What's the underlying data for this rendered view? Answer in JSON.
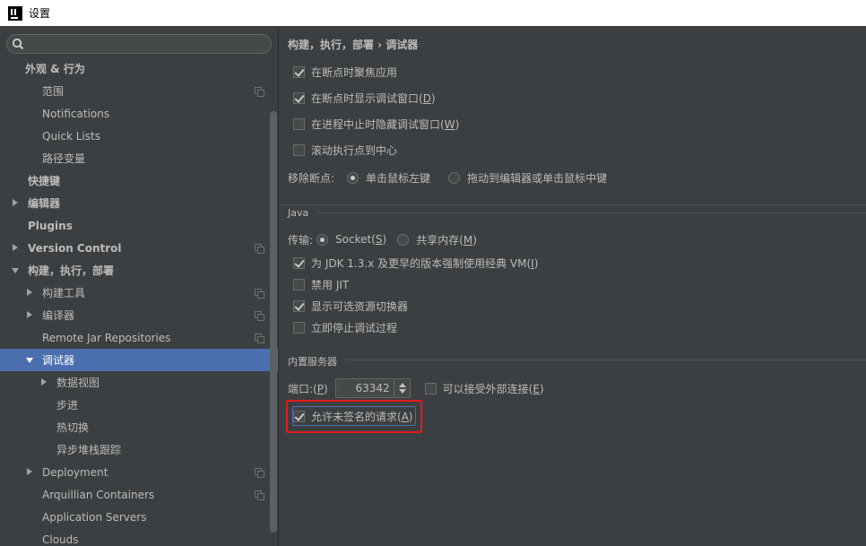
{
  "window": {
    "title": "设置"
  },
  "search": {
    "placeholder": ""
  },
  "sidebar": {
    "items": [
      {
        "label": "外观 & 行为",
        "indent": 28,
        "bold": true,
        "arrow": "none",
        "copy": false
      },
      {
        "label": "范围",
        "indent": 47,
        "bold": false,
        "arrow": "none",
        "copy": true
      },
      {
        "label": "Notifications",
        "indent": 47,
        "bold": false,
        "arrow": "none",
        "copy": false
      },
      {
        "label": "Quick Lists",
        "indent": 47,
        "bold": false,
        "arrow": "none",
        "copy": false
      },
      {
        "label": "路径变量",
        "indent": 47,
        "bold": false,
        "arrow": "none",
        "copy": false
      },
      {
        "label": "快捷键",
        "indent": 31,
        "bold": true,
        "arrow": "none",
        "copy": false
      },
      {
        "label": "编辑器",
        "indent": 31,
        "bold": true,
        "arrow": "right",
        "copy": false
      },
      {
        "label": "Plugins",
        "indent": 31,
        "bold": true,
        "arrow": "none",
        "copy": false
      },
      {
        "label": "Version Control",
        "indent": 31,
        "bold": true,
        "arrow": "right",
        "copy": true
      },
      {
        "label": "构建，执行，部署",
        "indent": 31,
        "bold": true,
        "arrow": "down",
        "copy": false
      },
      {
        "label": "构建工具",
        "indent": 47,
        "bold": false,
        "arrow": "right",
        "copy": true
      },
      {
        "label": "编译器",
        "indent": 47,
        "bold": false,
        "arrow": "right",
        "copy": true
      },
      {
        "label": "Remote Jar Repositories",
        "indent": 47,
        "bold": false,
        "arrow": "none",
        "copy": true
      },
      {
        "label": "调试器",
        "indent": 47,
        "bold": false,
        "arrow": "down",
        "copy": false,
        "selected": true
      },
      {
        "label": "数据视图",
        "indent": 63,
        "bold": false,
        "arrow": "right",
        "copy": false
      },
      {
        "label": "步进",
        "indent": 63,
        "bold": false,
        "arrow": "none",
        "copy": false
      },
      {
        "label": "热切换",
        "indent": 63,
        "bold": false,
        "arrow": "none",
        "copy": false
      },
      {
        "label": "异步堆栈跟踪",
        "indent": 63,
        "bold": false,
        "arrow": "none",
        "copy": false
      },
      {
        "label": "Deployment",
        "indent": 47,
        "bold": false,
        "arrow": "right",
        "copy": true
      },
      {
        "label": "Arquillian Containers",
        "indent": 47,
        "bold": false,
        "arrow": "none",
        "copy": true
      },
      {
        "label": "Application Servers",
        "indent": 47,
        "bold": false,
        "arrow": "none",
        "copy": false
      },
      {
        "label": "Clouds",
        "indent": 47,
        "bold": false,
        "arrow": "none",
        "copy": false
      }
    ]
  },
  "content": {
    "breadcrumb": "构建，执行，部署 › 调试器",
    "general": [
      {
        "label": "在断点时聚焦应用",
        "mnemonic": "",
        "checked": true
      },
      {
        "label": "在断点时显示调试窗口(",
        "mnemonic": "D",
        "suffix": ")",
        "checked": true
      },
      {
        "label": "在进程中止时隐藏调试窗口(",
        "mnemonic": "W",
        "suffix": ")",
        "checked": false
      },
      {
        "label": "滚动执行点到中心",
        "mnemonic": "",
        "checked": false
      }
    ],
    "remove_breakpoint": {
      "label": "移除断点:",
      "option1": "单击鼠标左键",
      "option2": "拖动到编辑器或单击鼠标中键",
      "selected": 1
    },
    "java": {
      "section": "Java",
      "transport_label": "传输:",
      "socket_label": "Socket(",
      "socket_mnemonic": "S",
      "shared_label": "共享内存(",
      "shared_mnemonic": "M",
      "selected": "socket",
      "options": [
        {
          "label": "为 JDK 1.3.x 及更早的版本强制使用经典 VM(",
          "mnemonic": "I",
          "suffix": ")",
          "checked": true
        },
        {
          "label": "禁用 JIT",
          "mnemonic": "",
          "suffix": "",
          "checked": false
        },
        {
          "label": "显示可选资源切换器",
          "mnemonic": "",
          "suffix": "",
          "checked": true
        },
        {
          "label": "立即停止调试过程",
          "mnemonic": "",
          "suffix": "",
          "checked": false
        }
      ]
    },
    "builtin_server": {
      "section": "内置服务器",
      "port_label": "端口:(",
      "port_mnemonic": "P",
      "port_suffix": ")",
      "port_value": "63342",
      "external_label": "可以接受外部连接(",
      "external_mnemonic": "E",
      "external_suffix": ")",
      "external_checked": false,
      "unsigned_label": "允许未签名的请求(",
      "unsigned_mnemonic": "A",
      "unsigned_suffix": ")",
      "unsigned_checked": true
    }
  },
  "colors": {
    "background": "#3c3f41",
    "selection": "#4b6eaf",
    "highlight": "#e31b1b",
    "text": "#bbbbbb"
  }
}
